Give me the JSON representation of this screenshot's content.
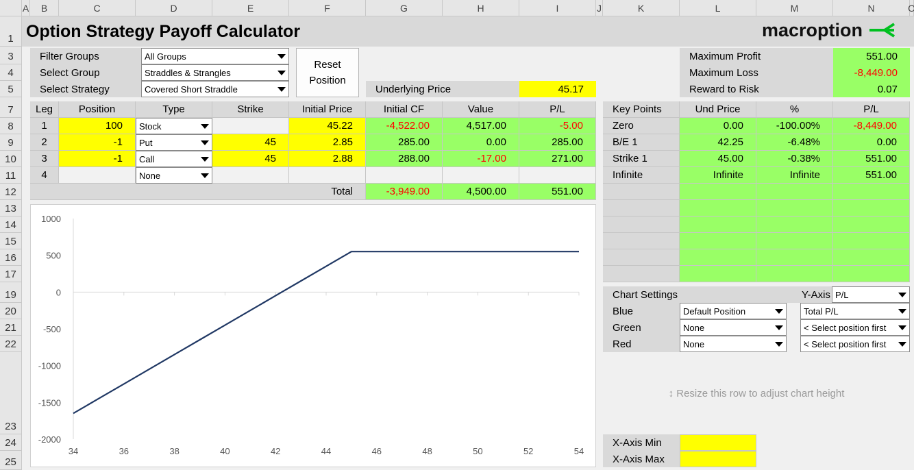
{
  "columns": [
    "A",
    "B",
    "C",
    "D",
    "E",
    "F",
    "G",
    "H",
    "I",
    "J",
    "K",
    "L",
    "M",
    "N",
    "O"
  ],
  "rows": [
    "1",
    "3",
    "4",
    "5",
    "7",
    "8",
    "9",
    "10",
    "11",
    "12",
    "13",
    "14",
    "15",
    "16",
    "17",
    "19",
    "20",
    "21",
    "22",
    "23",
    "24",
    "25"
  ],
  "title": "Option Strategy Payoff Calculator",
  "logo": {
    "text": "macroption",
    "accent": "#00c020"
  },
  "filters": {
    "filter_groups_label": "Filter Groups",
    "filter_groups_value": "All Groups",
    "select_group_label": "Select Group",
    "select_group_value": "Straddles & Strangles",
    "select_strategy_label": "Select Strategy",
    "select_strategy_value": "Covered Short Straddle"
  },
  "reset_button": {
    "line1": "Reset",
    "line2": "Position"
  },
  "underlying": {
    "label": "Underlying Price",
    "value": "45.17"
  },
  "summary": {
    "max_profit_label": "Maximum Profit",
    "max_profit_value": "551.00",
    "max_loss_label": "Maximum Loss",
    "max_loss_value": "-8,449.00",
    "rr_label": "Reward to Risk",
    "rr_value": "0.07"
  },
  "legs_table": {
    "headers": {
      "leg": "Leg",
      "position": "Position",
      "type": "Type",
      "strike": "Strike",
      "initial_price": "Initial Price",
      "initial_cf": "Initial CF",
      "value": "Value",
      "pl": "P/L"
    },
    "rows": [
      {
        "leg": "1",
        "position": "100",
        "type": "Stock",
        "strike": "",
        "initial_price": "45.22",
        "initial_cf": "-4,522.00",
        "value": "4,517.00",
        "pl": "-5.00"
      },
      {
        "leg": "2",
        "position": "-1",
        "type": "Put",
        "strike": "45",
        "initial_price": "2.85",
        "initial_cf": "285.00",
        "value": "0.00",
        "pl": "285.00"
      },
      {
        "leg": "3",
        "position": "-1",
        "type": "Call",
        "strike": "45",
        "initial_price": "2.88",
        "initial_cf": "288.00",
        "value": "-17.00",
        "pl": "271.00"
      },
      {
        "leg": "4",
        "position": "",
        "type": "None",
        "strike": "",
        "initial_price": "",
        "initial_cf": "",
        "value": "",
        "pl": ""
      }
    ],
    "total": {
      "label": "Total",
      "initial_cf": "-3,949.00",
      "value": "4,500.00",
      "pl": "551.00"
    }
  },
  "key_points": {
    "headers": {
      "name": "Key Points",
      "und_price": "Und Price",
      "pct": "%",
      "pl": "P/L"
    },
    "rows": [
      {
        "name": "Zero",
        "und_price": "0.00",
        "pct": "-100.00%",
        "pl": "-8,449.00"
      },
      {
        "name": "B/E 1",
        "und_price": "42.25",
        "pct": "-6.48%",
        "pl": "0.00"
      },
      {
        "name": "Strike 1",
        "und_price": "45.00",
        "pct": "-0.38%",
        "pl": "551.00"
      },
      {
        "name": "Infinite",
        "und_price": "Infinite",
        "pct": "Infinite",
        "pl": "551.00"
      }
    ]
  },
  "chart_settings": {
    "label": "Chart Settings",
    "yaxis_label": "Y-Axis",
    "yaxis_value": "P/L",
    "blue_label": "Blue",
    "blue_position": "Default Position",
    "blue_metric": "Total P/L",
    "green_label": "Green",
    "green_position": "None",
    "green_metric": "< Select position first",
    "red_label": "Red",
    "red_position": "None",
    "red_metric": "< Select position first"
  },
  "resize_hint": "↕ Resize this row to adjust chart height",
  "xaxis": {
    "min_label": "X-Axis Min",
    "min_value": "",
    "max_label": "X-Axis Max",
    "max_value": ""
  },
  "chart_data": {
    "type": "line",
    "x": [
      34,
      35,
      36,
      37,
      38,
      39,
      40,
      41,
      42,
      43,
      44,
      45,
      46,
      48,
      50,
      52,
      54
    ],
    "series": [
      {
        "values": [
          -1649,
          -1449,
          -1249,
          -1049,
          -849,
          -649,
          -449,
          -249,
          -49,
          151,
          351,
          551,
          551,
          551,
          551,
          551,
          551
        ],
        "color": "#203864"
      }
    ],
    "xticks": [
      34,
      36,
      38,
      40,
      42,
      44,
      46,
      48,
      50,
      52,
      54
    ],
    "yticks": [
      -2000,
      -1500,
      -1000,
      -500,
      0,
      500,
      1000
    ],
    "xlim": [
      34,
      54
    ],
    "ylim": [
      -2000,
      1000
    ],
    "grid": false
  }
}
